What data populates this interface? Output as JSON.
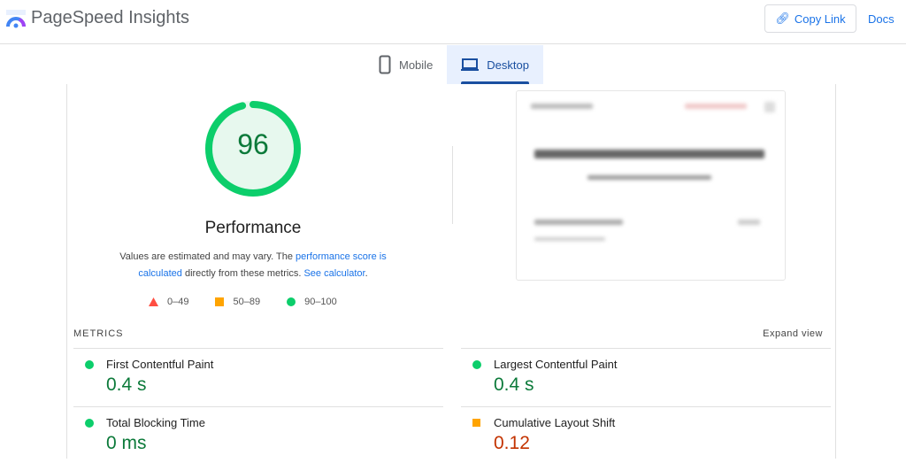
{
  "header": {
    "title": "PageSpeed Insights",
    "copy_link": "Copy Link",
    "docs": "Docs"
  },
  "tabs": [
    {
      "label": "Mobile"
    },
    {
      "label": "Desktop",
      "active": true
    }
  ],
  "score": {
    "value": "96",
    "fraction": 0.96,
    "label": "Performance",
    "color": "#0cce6b"
  },
  "description": {
    "pre": "Values are estimated and may vary. The ",
    "link1": "performance score is calculated",
    "mid": " directly from these metrics. ",
    "link2": "See calculator",
    "post": "."
  },
  "legend": [
    {
      "range": "0–49",
      "color": "#ff4e42"
    },
    {
      "range": "50–89",
      "color": "#ffa400"
    },
    {
      "range": "90–100",
      "color": "#0cce6b"
    }
  ],
  "metrics_heading": "METRICS",
  "expand": "Expand view",
  "metrics": [
    {
      "name": "First Contentful Paint",
      "value": "0.4 s",
      "status": "good"
    },
    {
      "name": "Largest Contentful Paint",
      "value": "0.4 s",
      "status": "good"
    },
    {
      "name": "Total Blocking Time",
      "value": "0 ms",
      "status": "good"
    },
    {
      "name": "Cumulative Layout Shift",
      "value": "0.12",
      "status": "average"
    }
  ]
}
